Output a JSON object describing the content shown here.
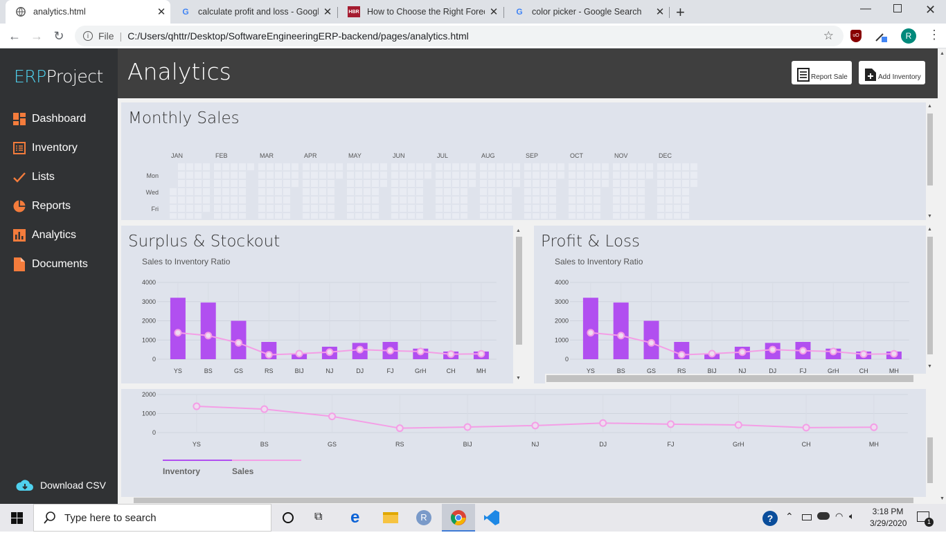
{
  "browser": {
    "tabs": [
      {
        "title": "analytics.html",
        "icon": "globe-icon",
        "active": true
      },
      {
        "title": "calculate profit and loss - Google",
        "icon": "google-icon",
        "active": false
      },
      {
        "title": "How to Choose the Right Foreca",
        "icon": "hbr-icon",
        "active": false
      },
      {
        "title": "color picker - Google Search",
        "icon": "google-icon",
        "active": false
      }
    ],
    "file_label": "File",
    "url": "C:/Users/qhttr/Desktop/SoftwareEngineeringERP-backend/pages/analytics.html",
    "profile_initial": "R"
  },
  "sidebar": {
    "brand_prefix": "ERP",
    "brand_suffix": "Project",
    "items": [
      {
        "label": "Dashboard",
        "icon": "dashboard-icon"
      },
      {
        "label": "Inventory",
        "icon": "list-icon"
      },
      {
        "label": "Lists",
        "icon": "check-icon"
      },
      {
        "label": "Reports",
        "icon": "pie-icon"
      },
      {
        "label": "Analytics",
        "icon": "bar-chart-icon"
      },
      {
        "label": "Documents",
        "icon": "document-icon"
      }
    ],
    "download_label": "Download CSV",
    "accent": "#f47c3c"
  },
  "header": {
    "title": "Analytics",
    "buttons": [
      {
        "label": "Report Sale",
        "icon": "report-icon"
      },
      {
        "label": "Add Inventory",
        "icon": "add-file-icon"
      }
    ]
  },
  "monthly": {
    "title": "Monthly Sales",
    "months": [
      "JAN",
      "FEB",
      "MAR",
      "APR",
      "MAY",
      "JUN",
      "JUL",
      "AUG",
      "SEP",
      "OCT",
      "NOV",
      "DEC"
    ],
    "days": [
      "Mon",
      "Wed",
      "Fri"
    ]
  },
  "chart_data": [
    {
      "type": "bar",
      "title": "Surplus & Stockout",
      "subtitle": "Sales to Inventory Ratio",
      "categories": [
        "YS",
        "BS",
        "GS",
        "RS",
        "BIJ",
        "NJ",
        "DJ",
        "FJ",
        "GrH",
        "CH",
        "MH"
      ],
      "series": [
        {
          "name": "Inventory",
          "type": "bar",
          "color": "#b14ff0",
          "values": [
            3200,
            2950,
            2000,
            900,
            300,
            650,
            850,
            900,
            550,
            400,
            400
          ]
        },
        {
          "name": "Sales",
          "type": "line",
          "color": "#f49ee6",
          "values": [
            1380,
            1230,
            850,
            230,
            290,
            370,
            500,
            440,
            400,
            260,
            280
          ]
        }
      ],
      "ylim": [
        0,
        4000
      ],
      "yticks": [
        0,
        1000,
        2000,
        3000,
        4000
      ]
    },
    {
      "type": "bar",
      "title": "Profit & Loss",
      "subtitle": "Sales to Inventory Ratio",
      "categories": [
        "YS",
        "BS",
        "GS",
        "RS",
        "BIJ",
        "NJ",
        "DJ",
        "FJ",
        "GrH",
        "CH",
        "MH"
      ],
      "series": [
        {
          "name": "Inventory",
          "type": "bar",
          "color": "#b14ff0",
          "values": [
            3200,
            2950,
            2000,
            900,
            300,
            650,
            850,
            900,
            550,
            400,
            400
          ]
        },
        {
          "name": "Sales",
          "type": "line",
          "color": "#f49ee6",
          "values": [
            1380,
            1230,
            850,
            230,
            290,
            370,
            500,
            440,
            400,
            260,
            280
          ]
        }
      ],
      "ylim": [
        0,
        4000
      ],
      "yticks": [
        0,
        1000,
        2000,
        3000,
        4000
      ]
    },
    {
      "type": "line",
      "title": "",
      "subtitle": "",
      "categories": [
        "YS",
        "BS",
        "GS",
        "RS",
        "BIJ",
        "NJ",
        "DJ",
        "FJ",
        "GrH",
        "CH",
        "MH"
      ],
      "series": [
        {
          "name": "Sales",
          "color": "#f49ee6",
          "values": [
            1380,
            1230,
            850,
            230,
            290,
            370,
            500,
            440,
            400,
            260,
            280
          ]
        }
      ],
      "ylim": [
        0,
        2000
      ],
      "yticks": [
        0,
        1000,
        2000
      ],
      "legend": [
        "Inventory",
        "Sales"
      ]
    }
  ],
  "taskbar": {
    "search_placeholder": "Type here to search",
    "time": "3:18 PM",
    "date": "3/29/2020",
    "notification_count": "1"
  }
}
